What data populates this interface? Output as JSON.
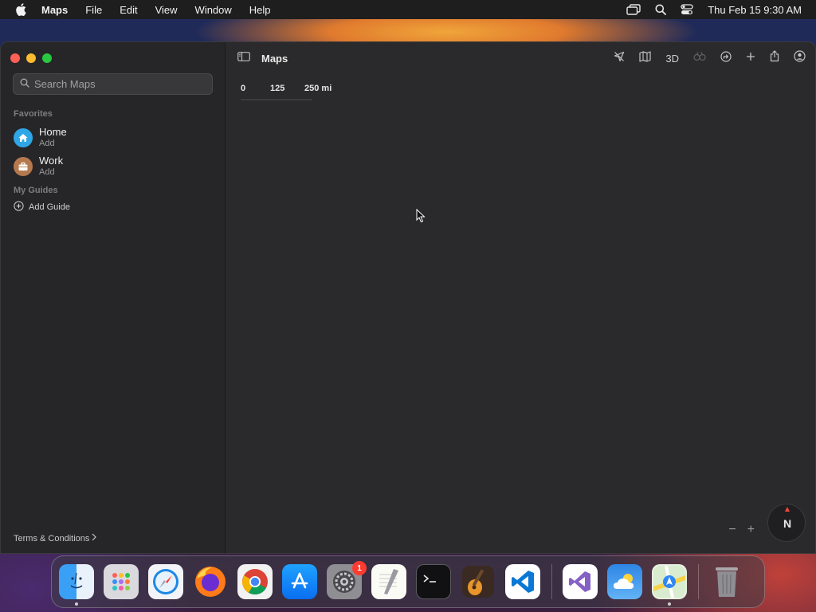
{
  "menubar": {
    "app_name": "Maps",
    "items": [
      "File",
      "Edit",
      "View",
      "Window",
      "Help"
    ],
    "datetime": "Thu Feb 15  9:30 AM"
  },
  "window": {
    "title": "Maps",
    "search_placeholder": "Search Maps",
    "favorites_title": "Favorites",
    "favorites": [
      {
        "name": "Home",
        "sub": "Add",
        "color": "#2fa6e6"
      },
      {
        "name": "Work",
        "sub": "Add",
        "color": "#b5794f"
      }
    ],
    "guides_title": "My Guides",
    "add_guide": "Add Guide",
    "terms": "Terms & Conditions",
    "toolbar_3d": "3D"
  },
  "map": {
    "scale": {
      "zero": "0",
      "mid": "125",
      "end": "250 mi"
    },
    "compass": "N",
    "zoom_out": "−",
    "zoom_in": "+"
  },
  "dock": {
    "apps": [
      "Finder",
      "Launchpad",
      "Safari",
      "Firefox",
      "Chrome",
      "App Store",
      "System Settings",
      "TextEdit",
      "Terminal",
      "GarageBand",
      "Visual Studio Code",
      "Visual Studio",
      "Weather",
      "Maps",
      "Trash"
    ],
    "settings_badge": "1"
  }
}
